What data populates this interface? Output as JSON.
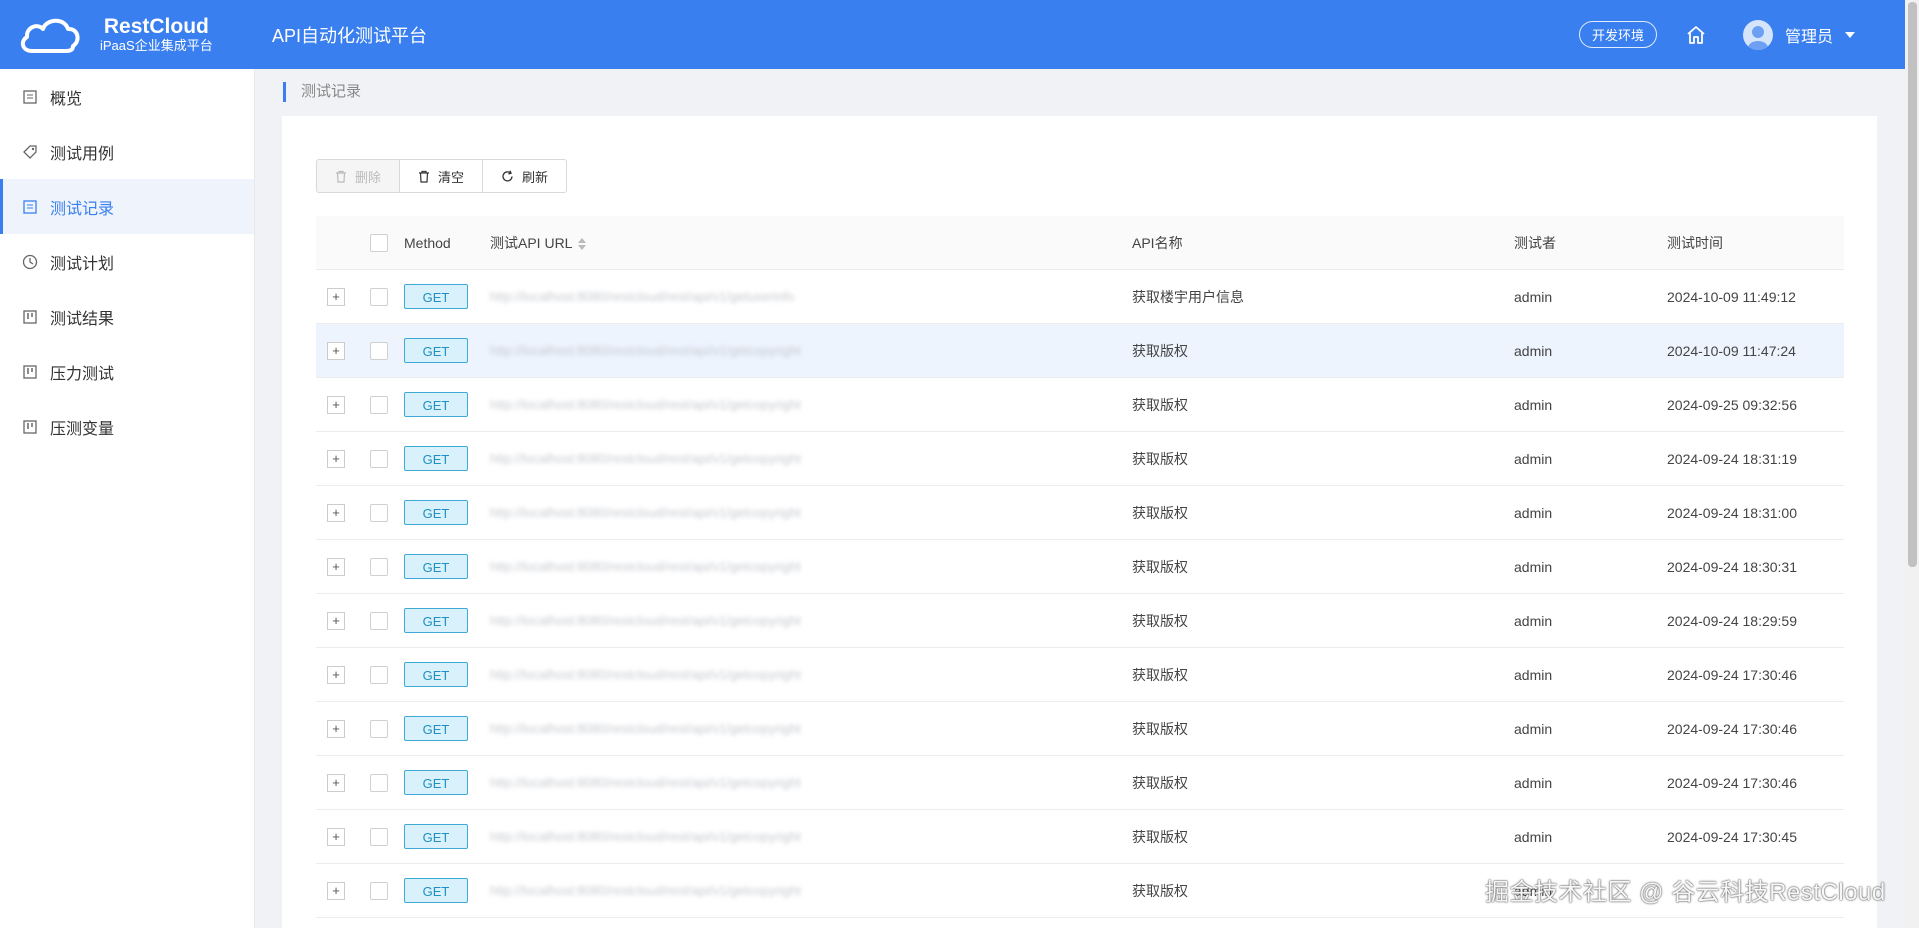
{
  "header": {
    "logo_name": "RestCloud",
    "logo_sub": "iPaaS企业集成平台",
    "app_title": "API自动化测试平台",
    "env_label": "开发环境",
    "user_name": "管理员",
    "bg_color": "#3a7ff0"
  },
  "sidebar": {
    "items": [
      {
        "label": "概览",
        "icon": "overview-icon"
      },
      {
        "label": "测试用例",
        "icon": "tag-icon"
      },
      {
        "label": "测试记录",
        "icon": "list-icon",
        "active": true
      },
      {
        "label": "测试计划",
        "icon": "clock-icon"
      },
      {
        "label": "测试结果",
        "icon": "board-icon"
      },
      {
        "label": "压力测试",
        "icon": "board-icon"
      },
      {
        "label": "压测变量",
        "icon": "board-icon"
      }
    ]
  },
  "breadcrumb": "测试记录",
  "toolbar": {
    "delete_label": "删除",
    "clear_label": "清空",
    "refresh_label": "刷新"
  },
  "table": {
    "columns": {
      "method": "Method",
      "url": "测试API URL",
      "api_name": "API名称",
      "tester": "测试者",
      "time": "测试时间"
    },
    "rows": [
      {
        "method": "GET",
        "url": "http://localhost:8080/restcloud/rest/api/v1/getuserinfo",
        "api_name": "获取楼宇用户信息",
        "tester": "admin",
        "time": "2024-10-09 11:49:12"
      },
      {
        "method": "GET",
        "url": "http://localhost:8080/restcloud/rest/api/v1/getcopyright",
        "api_name": "获取版权",
        "tester": "admin",
        "time": "2024-10-09 11:47:24"
      },
      {
        "method": "GET",
        "url": "http://localhost:8080/restcloud/rest/api/v1/getcopyright",
        "api_name": "获取版权",
        "tester": "admin",
        "time": "2024-09-25 09:32:56"
      },
      {
        "method": "GET",
        "url": "http://localhost:8080/restcloud/rest/api/v1/getcopyright",
        "api_name": "获取版权",
        "tester": "admin",
        "time": "2024-09-24 18:31:19"
      },
      {
        "method": "GET",
        "url": "http://localhost:8080/restcloud/rest/api/v1/getcopyright",
        "api_name": "获取版权",
        "tester": "admin",
        "time": "2024-09-24 18:31:00"
      },
      {
        "method": "GET",
        "url": "http://localhost:8080/restcloud/rest/api/v1/getcopyright",
        "api_name": "获取版权",
        "tester": "admin",
        "time": "2024-09-24 18:30:31"
      },
      {
        "method": "GET",
        "url": "http://localhost:8080/restcloud/rest/api/v1/getcopyright",
        "api_name": "获取版权",
        "tester": "admin",
        "time": "2024-09-24 18:29:59"
      },
      {
        "method": "GET",
        "url": "http://localhost:8080/restcloud/rest/api/v1/getcopyright",
        "api_name": "获取版权",
        "tester": "admin",
        "time": "2024-09-24 17:30:46"
      },
      {
        "method": "GET",
        "url": "http://localhost:8080/restcloud/rest/api/v1/getcopyright",
        "api_name": "获取版权",
        "tester": "admin",
        "time": "2024-09-24 17:30:46"
      },
      {
        "method": "GET",
        "url": "http://localhost:8080/restcloud/rest/api/v1/getcopyright",
        "api_name": "获取版权",
        "tester": "admin",
        "time": "2024-09-24 17:30:46"
      },
      {
        "method": "GET",
        "url": "http://localhost:8080/restcloud/rest/api/v1/getcopyright",
        "api_name": "获取版权",
        "tester": "admin",
        "time": "2024-09-24 17:30:45"
      },
      {
        "method": "GET",
        "url": "http://localhost:8080/restcloud/rest/api/v1/getcopyright",
        "api_name": "获取版权",
        "tester": "admin",
        "time": ""
      }
    ],
    "highlighted_row": 1
  },
  "watermark": "掘金技术社区 @ 谷云科技RestCloud"
}
